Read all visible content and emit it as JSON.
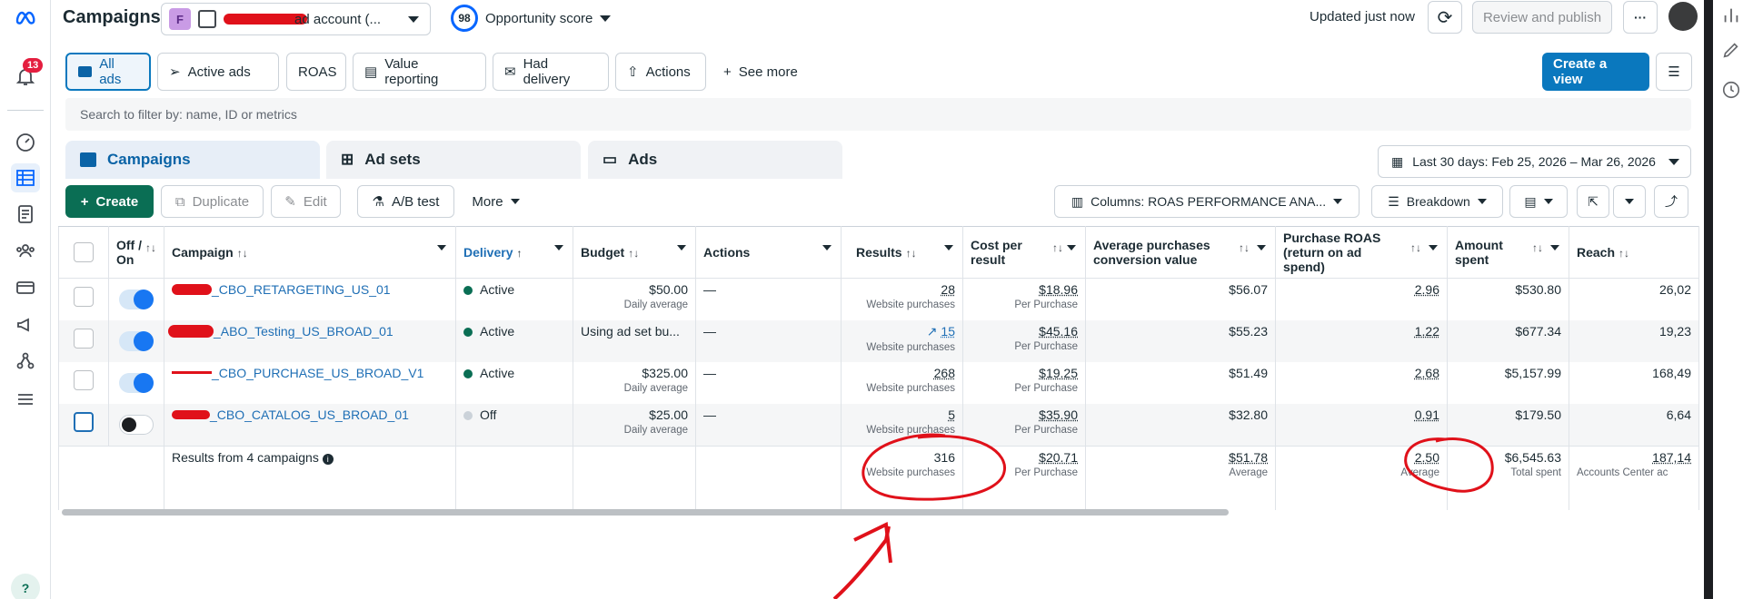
{
  "topbar": {
    "title": "Campaigns",
    "account_initial": "F",
    "account_name": "ad account (...",
    "opportunity_score": "98",
    "opportunity_label": "Opportunity score",
    "updated": "Updated just now",
    "review_publish": "Review and publish",
    "notif_count": "13"
  },
  "views": [
    {
      "label": "All ads",
      "selected": true
    },
    {
      "label": "Active ads"
    },
    {
      "label": "ROAS"
    },
    {
      "label": "Value reporting"
    },
    {
      "label": "Had delivery"
    },
    {
      "label": "Actions"
    },
    {
      "label": "See more"
    }
  ],
  "create_view": "Create a view",
  "search": {
    "placeholder": "Search to filter by: name, ID or metrics"
  },
  "object_tabs": [
    {
      "label": "Campaigns",
      "selected": true
    },
    {
      "label": "Ad sets"
    },
    {
      "label": "Ads"
    }
  ],
  "date_range": "Last 30 days: Feb 25, 2026 – Mar 26, 2026",
  "actionbar": {
    "create": "Create",
    "duplicate": "Duplicate",
    "edit": "Edit",
    "ab_test": "A/B test",
    "more": "More"
  },
  "columns_btn": "Columns: ROAS PERFORMANCE ANA...",
  "breakdown_btn": "Breakdown",
  "headers": {
    "offon": "Off / On",
    "campaign": "Campaign",
    "delivery": "Delivery",
    "budget": "Budget",
    "actions": "Actions",
    "results": "Results",
    "cpr": "Cost per result",
    "apcv": "Average purchases conversion value",
    "roas": "Purchase ROAS (return on ad spend)",
    "amount": "Amount spent",
    "reach": "Reach"
  },
  "rows": [
    {
      "campaign": "_CBO_RETARGETING_US_01",
      "delivery": "Active",
      "budget": "$50.00",
      "budget_sub": "Daily average",
      "actions": "—",
      "results": "28",
      "results_sub": "Website purchases",
      "cpr": "$18.96",
      "cpr_sub": "Per Purchase",
      "apcv": "$56.07",
      "roas": "2.96",
      "amount": "$530.80",
      "reach": "26,02"
    },
    {
      "campaign": "_ABO_Testing_US_BROAD_01",
      "delivery": "Active",
      "budget": "Using ad set bu...",
      "budget_sub": "",
      "actions": "—",
      "results": "15",
      "results_sub": "Website purchases",
      "cpr": "$45.16",
      "cpr_sub": "Per Purchase",
      "apcv": "$55.23",
      "roas": "1.22",
      "amount": "$677.34",
      "reach": "19,23"
    },
    {
      "campaign": "_CBO_PURCHASE_US_BROAD_V1",
      "delivery": "Active",
      "budget": "$325.00",
      "budget_sub": "Daily average",
      "actions": "—",
      "results": "268",
      "results_sub": "Website purchases",
      "cpr": "$19.25",
      "cpr_sub": "Per Purchase",
      "apcv": "$51.49",
      "roas": "2.68",
      "amount": "$5,157.99",
      "reach": "168,49"
    },
    {
      "campaign": "_CBO_CATALOG_US_BROAD_01",
      "delivery": "Off",
      "budget": "$25.00",
      "budget_sub": "Daily average",
      "actions": "—",
      "results": "5",
      "results_sub": "Website purchases",
      "cpr": "$35.90",
      "cpr_sub": "Per Purchase",
      "apcv": "$32.80",
      "roas": "0.91",
      "amount": "$179.50",
      "reach": "6,64"
    }
  ],
  "summary": {
    "label": "Results from 4 campaigns",
    "results": "316",
    "results_sub": "Website purchases",
    "cpr": "$20.71",
    "cpr_sub": "Per Purchase",
    "apcv": "$51.78",
    "apcv_sub": "Average",
    "roas": "2.50",
    "roas_sub": "Average",
    "amount": "$6,545.63",
    "amount_sub": "Total spent",
    "reach": "187,14",
    "reach_sub": "Accounts Center ac"
  },
  "colors": {
    "accent": "#0a78be",
    "active": "#0a6e54",
    "annotation": "#e0111a"
  }
}
